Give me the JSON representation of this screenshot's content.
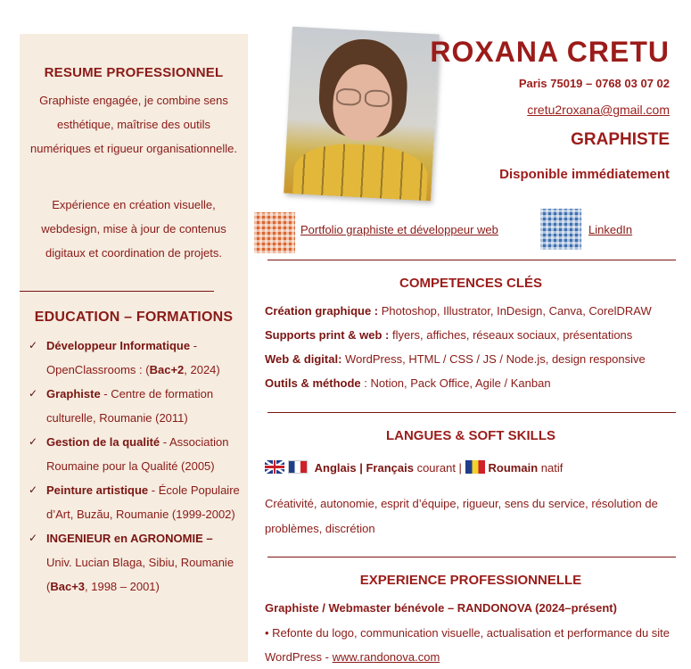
{
  "header": {
    "name": "ROXANA CRETU",
    "location_phone": "Paris 75019 – 0768 03 07 02",
    "email": "cretu2roxana@gmail.com",
    "role": "GRAPHISTE",
    "availability": "Disponible immédiatement"
  },
  "links": {
    "portfolio": "Portfolio graphiste et développeur web",
    "linkedin": "LinkedIn"
  },
  "sidebar": {
    "resume_title": "RESUME PROFESSIONNEL",
    "resume_p1": "Graphiste engagée, je combine sens esthétique, maîtrise des outils numériques et rigueur organisationnelle.",
    "resume_p2": "Expérience en création visuelle, webdesign, mise à jour de contenus digitaux et coordination de projets.",
    "education_title": "EDUCATION – FORMATIONS",
    "education": [
      {
        "bold": "Développeur Informatique",
        "pre": " - OpenClassrooms : (",
        "bold2": "Bac+2",
        "post": ", 2024)"
      },
      {
        "bold": "Graphiste",
        "pre": " - Centre de formation culturelle, Roumanie (2011)",
        "bold2": "",
        "post": ""
      },
      {
        "bold": "Gestion de la qualité",
        "pre": " - Association Roumaine pour la Qualité (2005)",
        "bold2": "",
        "post": ""
      },
      {
        "bold": "Peinture artistique",
        "pre": " - École Populaire d’Art, Buzău, Roumanie (1999-2002)",
        "bold2": "",
        "post": ""
      },
      {
        "bold": "INGENIEUR en AGRONOMIE –",
        "pre": " Univ. Lucian Blaga, Sibiu, Roumanie (",
        "bold2": "Bac+3",
        "post": ", 1998 – 2001)"
      }
    ]
  },
  "competences": {
    "title": "COMPETENCES CLÉS",
    "items": [
      {
        "label": "Création graphique :",
        "text": " Photoshop, Illustrator, InDesign, Canva, CorelDRAW"
      },
      {
        "label": "Supports print & web :",
        "text": " flyers, affiches, réseaux sociaux, présentations"
      },
      {
        "label": "Web & digital:",
        "text": " WordPress, HTML / CSS / JS / Node.js, design responsive"
      },
      {
        "label": "Outils & méthode",
        "text": " : Notion, Pack Office, Agile / Kanban"
      }
    ]
  },
  "langues": {
    "title": "LANGUES & SOFT SKILLS",
    "anglais": "Anglais",
    "sep1": " | ",
    "francais": "Français",
    "courant": " courant | ",
    "roumain": "Roumain",
    "natif": " natif",
    "soft_skills": "Créativité, autonomie, esprit d’équipe, rigueur, sens du service, résolution de problèmes, discrétion"
  },
  "experience": {
    "title": "EXPERIENCE PROFESSIONNELLE",
    "job_title": "Graphiste / Webmaster bénévole – RANDONOVA (2024–présent)",
    "desc": "• Refonte du logo, communication visuelle, actualisation et performance du site WordPress - ",
    "link": "www.randonova.com"
  }
}
